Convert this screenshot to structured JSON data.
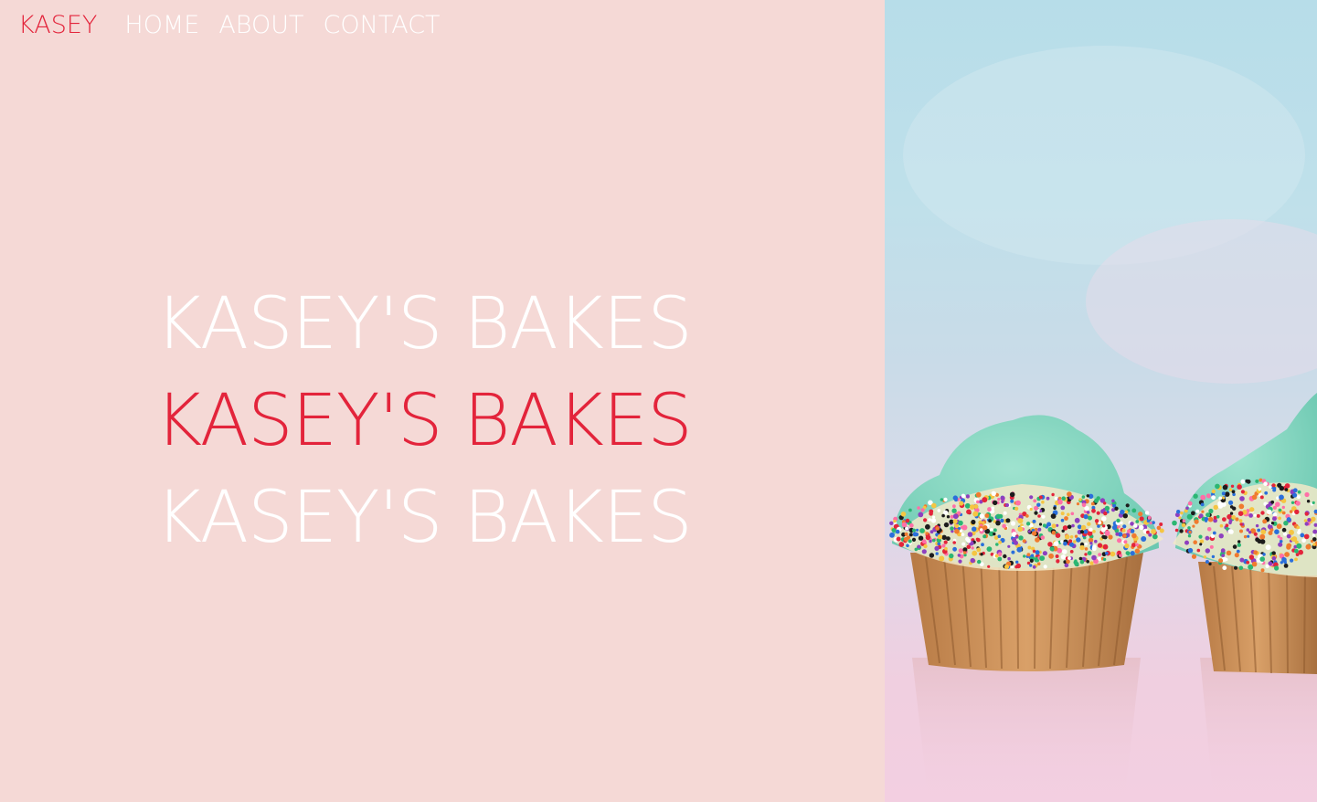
{
  "nav": {
    "brand": "KASEY",
    "links": [
      "HOME",
      "ABOUT",
      "CONTACT"
    ]
  },
  "hero": {
    "lines": [
      "KASEY'S BAKES",
      "KASEY'S BAKES",
      "KASEY'S BAKES"
    ]
  },
  "colors": {
    "accent": "#e3243b",
    "panel_bg": "#f5d9d6",
    "text_light": "#ffffff"
  },
  "image": {
    "subject": "cupcakes-photo"
  }
}
